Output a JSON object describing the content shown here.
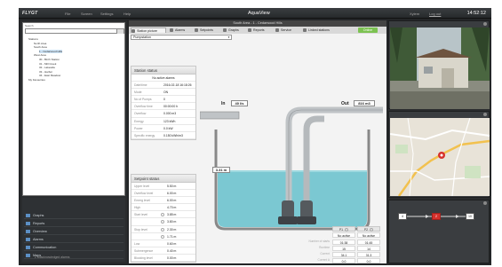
{
  "app": {
    "brand": "FLYGT",
    "title": "AquaView",
    "menu": [
      "File",
      "Screen",
      "Settings",
      "Help"
    ],
    "user": "Xylem",
    "logout": "Log out",
    "time": "14:52:12"
  },
  "tree": {
    "search_placeholder": "Search",
    "nodes": [
      {
        "label": "Stations",
        "level": 0
      },
      {
        "label": "North Area",
        "level": 1
      },
      {
        "label": "South Area",
        "level": 1
      },
      {
        "label": "1 - Cedarwood Hills",
        "level": 2,
        "selected": true
      },
      {
        "label": "West Area",
        "level": 1
      },
      {
        "label": "30 - Birch Station",
        "level": 2
      },
      {
        "label": "31 - Mill Creek",
        "level": 2
      },
      {
        "label": "32 - Lakeside",
        "level": 2
      },
      {
        "label": "33 - Harbor",
        "level": 2
      },
      {
        "label": "34 - East Meadow",
        "level": 2
      },
      {
        "label": "My Favourites",
        "level": 0
      }
    ]
  },
  "nav": {
    "items": [
      "Graphs",
      "Reports",
      "Overview",
      "Alarms",
      "Communication",
      "Maps"
    ],
    "active": 0,
    "footer": "2 unacknowledged alarms"
  },
  "center": {
    "window_title": "South Area - 1 - Cedarwood Hills",
    "tabs": [
      "Station picture",
      "Alarms",
      "Setpoints",
      "Graphs",
      "Reports",
      "Service",
      "Linked stations"
    ],
    "status_badge": "Online",
    "dropdown": "Pumpstation"
  },
  "station_status": {
    "title": "Station status",
    "status_text": "No active alarms",
    "rows": [
      {
        "label": "Date/time",
        "value": "2016-02-18 16:18:26"
      },
      {
        "label": "Mode",
        "value": "ON"
      },
      {
        "label": "No of Pumps",
        "value": "0"
      },
      {
        "label": "Overflow time",
        "value": "00:00:00 h"
      },
      {
        "label": "Overflow",
        "value": "0.000 m3"
      },
      {
        "label": "Energy",
        "value": "123 kWh"
      },
      {
        "label": "Power",
        "value": "0.0 kW"
      },
      {
        "label": "Specific energy",
        "value": "0.150 kWh/m3"
      }
    ]
  },
  "setpoint_status": {
    "title": "Setpoint status",
    "rows": [
      {
        "label": "Upper level",
        "value": "5.50 m"
      },
      {
        "label": "Overflow level",
        "value": "6.00 m"
      },
      {
        "label": "Emerg level",
        "value": "6.00 m"
      },
      {
        "label": "High",
        "value": "4.70 m"
      },
      {
        "label": "Start level",
        "value": "3.85 m"
      },
      {
        "label": "",
        "value": "3.80 m"
      },
      {
        "label": "Stop level",
        "value": "2.30 m"
      },
      {
        "label": "",
        "value": "1.71 m"
      },
      {
        "label": "Low",
        "value": "0.60 m"
      },
      {
        "label": "Submergence",
        "value": "0.40 m"
      },
      {
        "label": "Blocking level",
        "value": "0.00 m"
      }
    ]
  },
  "schematic": {
    "in_label": "In",
    "in_value": "40 l/s",
    "out_label": "Out",
    "out_value": "816 m3",
    "level_value": "3.31 m"
  },
  "pumps": {
    "columns": [
      "P1",
      "P2"
    ],
    "row_labels": [
      "Number of starts",
      "Runtime",
      "Current",
      "Current A"
    ],
    "status": [
      "No active alarms",
      "No active alarms"
    ],
    "rows": [
      [
        "01:38",
        "01:45"
      ],
      [
        "15",
        "14"
      ],
      [
        "34.1",
        "31.3"
      ],
      [
        "0.0",
        "0.0"
      ]
    ]
  },
  "sequence": {
    "boxes": [
      "4",
      "2",
      "10"
    ],
    "active_index": 1
  },
  "colors": {
    "accent_blue": "#5c8fc4",
    "online_green": "#7cc251",
    "water": "#7bc8d2",
    "active_pump": "#d6312c"
  }
}
